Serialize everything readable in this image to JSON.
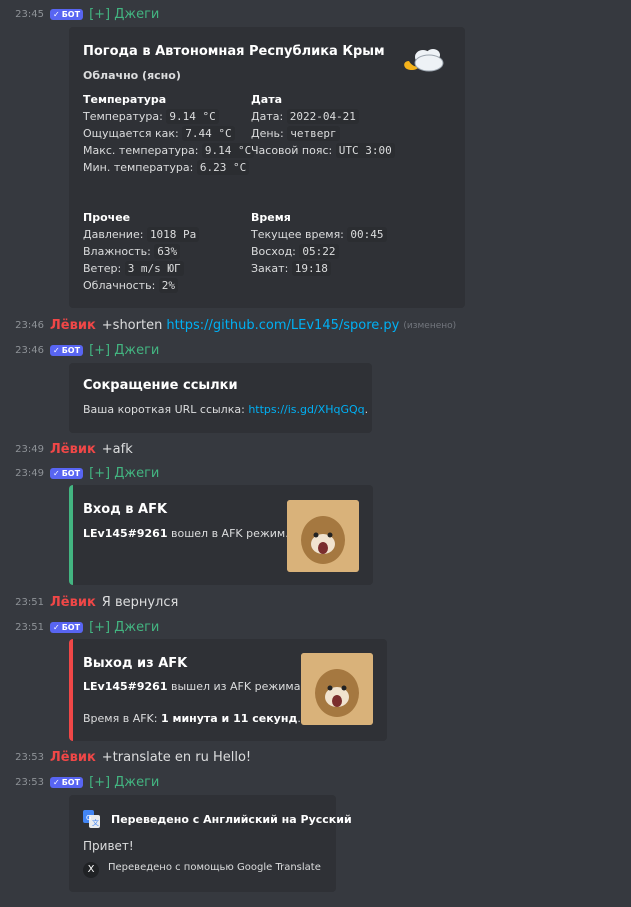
{
  "messages": [
    {
      "time": "23:45",
      "bot_label": "БОТ",
      "author": "[+] Джеги"
    },
    {
      "time": "23:46",
      "author": "Лёвик",
      "text": "+shorten",
      "link": "https://github.com/LEv145/spore.py",
      "edited": "(изменено)"
    },
    {
      "time": "23:46",
      "bot_label": "БОТ",
      "author": "[+] Джеги"
    },
    {
      "time": "23:49",
      "author": "Лёвик",
      "text": "+afk"
    },
    {
      "time": "23:49",
      "bot_label": "БОТ",
      "author": "[+] Джеги"
    },
    {
      "time": "23:51",
      "author": "Лёвик",
      "text": "Я вернулся"
    },
    {
      "time": "23:51",
      "bot_label": "БОТ",
      "author": "[+] Джеги"
    },
    {
      "time": "23:53",
      "author": "Лёвик",
      "text": "+translate en ru Hello!"
    },
    {
      "time": "23:53",
      "bot_label": "БОТ",
      "author": "[+] Джеги"
    }
  ],
  "weather": {
    "title": "Погода в Автономная Республика Крым",
    "subtitle": "Облачно (ясно)",
    "temp_head": "Температура",
    "temp_rows": [
      {
        "label": "Температура:",
        "value": "9.14 °C"
      },
      {
        "label": "Ощущается как:",
        "value": "7.44 °C"
      },
      {
        "label": "Макс. температура:",
        "value": "9.14 °C"
      },
      {
        "label": "Мин. температура:",
        "value": "6.23 °C"
      }
    ],
    "date_head": "Дата",
    "date_rows": [
      {
        "label": "Дата:",
        "value": "2022-04-21"
      },
      {
        "label": "День:",
        "value": "четверг"
      },
      {
        "label": "Часовой пояс:",
        "value": "UTC 3:00"
      }
    ],
    "other_head": "Прочее",
    "other_rows": [
      {
        "label": "Давление:",
        "value": "1018 Pa"
      },
      {
        "label": "Влажность:",
        "value": "63%"
      },
      {
        "label": "Ветер:",
        "value": "3 m/s ЮГ"
      },
      {
        "label": "Облачность:",
        "value": "2%"
      }
    ],
    "time_head": "Время",
    "time_rows": [
      {
        "label": "Текущее время:",
        "value": "00:45"
      },
      {
        "label": "Восход:",
        "value": "05:22"
      },
      {
        "label": "Закат:",
        "value": "19:18"
      }
    ]
  },
  "shorten": {
    "title": "Сокращение ссылки",
    "text": "Ваша короткая URL ссылка:",
    "link": "https://is.gd/XHqGQq"
  },
  "afk_in": {
    "title": "Вход в AFK",
    "user": "LEv145#9261",
    "text": "вошел в AFK режим."
  },
  "afk_out": {
    "title": "Выход из AFK",
    "user": "LEv145#9261",
    "text": "вышел из AFK режима.",
    "time_label": "Время в AFK:",
    "time_value": "1 минута и 11 секунд"
  },
  "translate": {
    "title": "Переведено с Английский на Русский",
    "text": "Привет!",
    "footer": "Переведено с помощью Google Translate"
  },
  "colors": {
    "background": "#36393f",
    "embed": "#2f3136",
    "accent_green": "#43b581",
    "accent_red": "#f04747",
    "bot_badge": "#5865f2",
    "link": "#00b0f4"
  }
}
